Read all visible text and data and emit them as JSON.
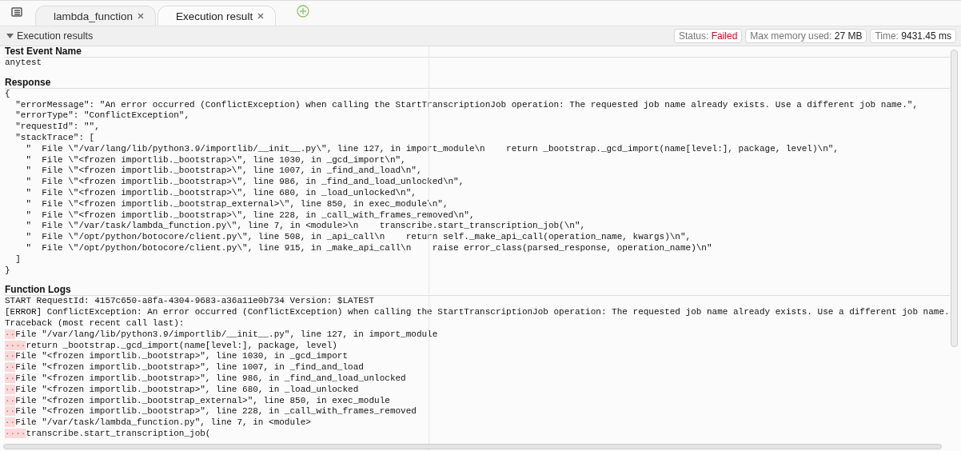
{
  "tabs": [
    {
      "label": "lambda_function",
      "selected": false
    },
    {
      "label": "Execution result",
      "selected": true
    }
  ],
  "panel": {
    "title": "Execution results",
    "expanded": true,
    "badges": [
      {
        "label": "Status:",
        "value": "Failed",
        "kind": "status"
      },
      {
        "label": "Max memory used:",
        "value": "27 MB",
        "kind": "metric"
      },
      {
        "label": "Time:",
        "value": "9431.45 ms",
        "kind": "metric"
      }
    ]
  },
  "sections": [
    {
      "title": "Test Event Name",
      "lines": [
        {
          "text": "anytest"
        }
      ]
    },
    {
      "title": "Response",
      "lines": [
        {
          "text": "{"
        },
        {
          "text": "  \"errorMessage\": \"An error occurred (ConflictException) when calling the StartTranscriptionJob operation: The requested job name already exists. Use a different job name.\","
        },
        {
          "text": "  \"errorType\": \"ConflictException\","
        },
        {
          "text": "  \"requestId\": \"\","
        },
        {
          "text": "  \"stackTrace\": ["
        },
        {
          "text": "    \"  File \\\"/var/lang/lib/python3.9/importlib/__init__.py\\\", line 127, in import_module\\n    return _bootstrap._gcd_import(name[level:], package, level)\\n\","
        },
        {
          "text": "    \"  File \\\"<frozen importlib._bootstrap>\\\", line 1030, in _gcd_import\\n\","
        },
        {
          "text": "    \"  File \\\"<frozen importlib._bootstrap>\\\", line 1007, in _find_and_load\\n\","
        },
        {
          "text": "    \"  File \\\"<frozen importlib._bootstrap>\\\", line 986, in _find_and_load_unlocked\\n\","
        },
        {
          "text": "    \"  File \\\"<frozen importlib._bootstrap>\\\", line 680, in _load_unlocked\\n\","
        },
        {
          "text": "    \"  File \\\"<frozen importlib._bootstrap_external>\\\", line 850, in exec_module\\n\","
        },
        {
          "text": "    \"  File \\\"<frozen importlib._bootstrap>\\\", line 228, in _call_with_frames_removed\\n\","
        },
        {
          "text": "    \"  File \\\"/var/task/lambda_function.py\\\", line 7, in <module>\\n    transcribe.start_transcription_job(\\n\","
        },
        {
          "text": "    \"  File \\\"/opt/python/botocore/client.py\\\", line 508, in _api_call\\n    return self._make_api_call(operation_name, kwargs)\\n\","
        },
        {
          "text": "    \"  File \\\"/opt/python/botocore/client.py\\\", line 915, in _make_api_call\\n    raise error_class(parsed_response, operation_name)\\n\""
        },
        {
          "text": "  ]"
        },
        {
          "text": "}"
        }
      ]
    },
    {
      "title": "Function Logs",
      "lines": [
        {
          "text": "START RequestId: 4157c650-a8fa-4304-9683-a36a11e0b734 Version: $LATEST"
        },
        {
          "text": "[ERROR] ConflictException: An error occurred (ConflictException) when calling the StartTranscriptionJob operation: The requested job name already exists. Use a different job name."
        },
        {
          "text": "Traceback (most recent call last):"
        },
        {
          "indent": "··",
          "text": "File \"/var/lang/lib/python3.9/importlib/__init__.py\", line 127, in import_module"
        },
        {
          "indent": "····",
          "text": "return _bootstrap._gcd_import(name[level:], package, level)"
        },
        {
          "indent": "··",
          "text": "File \"<frozen importlib._bootstrap>\", line 1030, in _gcd_import"
        },
        {
          "indent": "··",
          "text": "File \"<frozen importlib._bootstrap>\", line 1007, in _find_and_load"
        },
        {
          "indent": "··",
          "text": "File \"<frozen importlib._bootstrap>\", line 986, in _find_and_load_unlocked"
        },
        {
          "indent": "··",
          "text": "File \"<frozen importlib._bootstrap>\", line 680, in _load_unlocked"
        },
        {
          "indent": "··",
          "text": "File \"<frozen importlib._bootstrap_external>\", line 850, in exec_module"
        },
        {
          "indent": "··",
          "text": "File \"<frozen importlib._bootstrap>\", line 228, in _call_with_frames_removed"
        },
        {
          "indent": "··",
          "text": "File \"/var/task/lambda_function.py\", line 7, in <module>"
        },
        {
          "indent": "····",
          "text": "transcribe.start_transcription_job("
        }
      ]
    }
  ]
}
